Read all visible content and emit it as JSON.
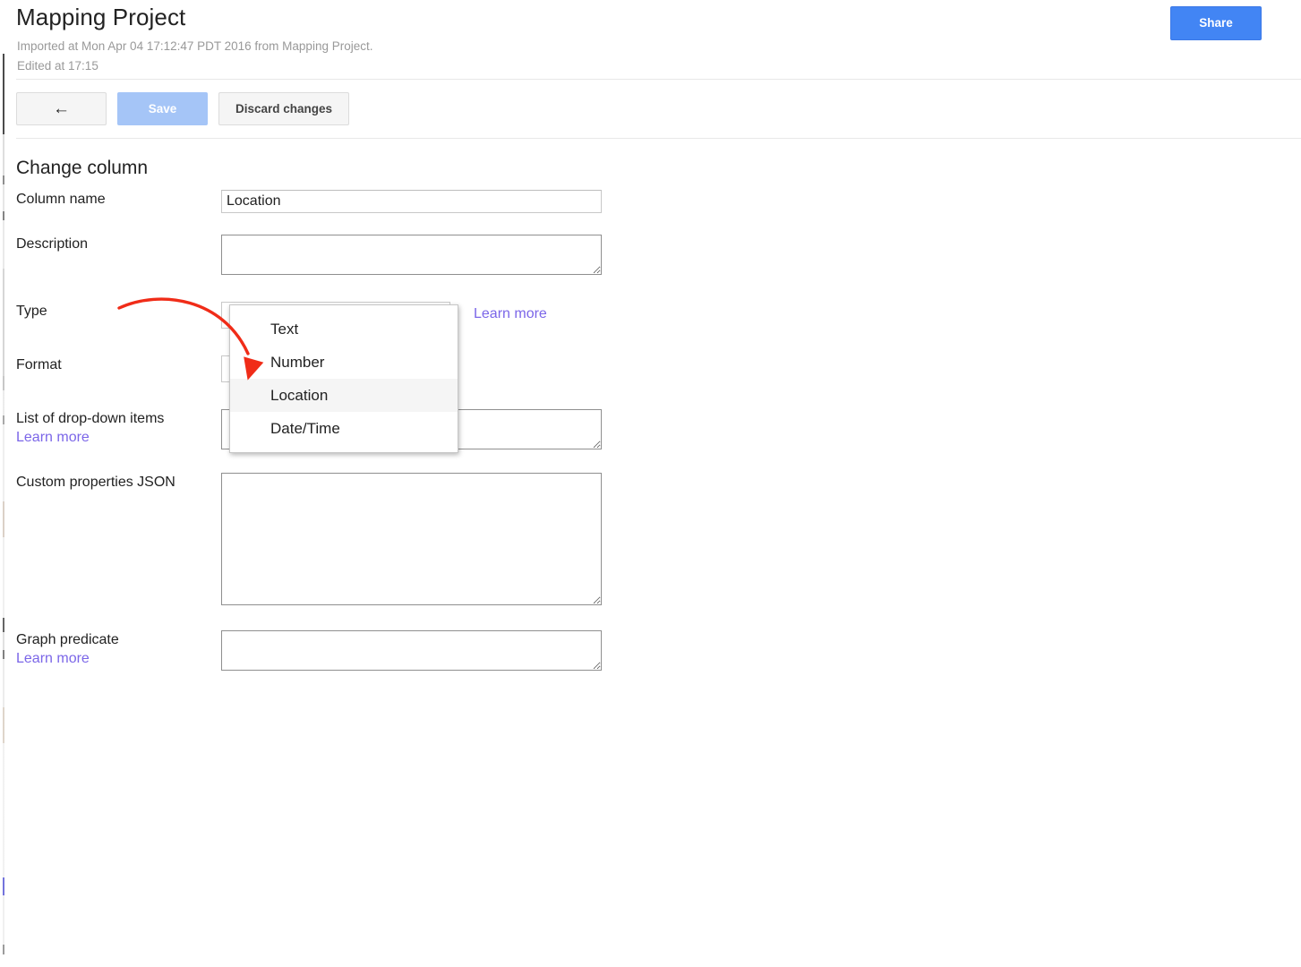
{
  "header": {
    "title": "Mapping Project",
    "imported_line": "Imported at Mon Apr 04 17:12:47 PDT 2016 from Mapping Project.",
    "edited_line": "Edited at 17:15",
    "share_label": "Share"
  },
  "toolbar": {
    "undo_icon": "undo-arrow-icon",
    "undo_glyph": "←",
    "save_label": "Save",
    "discard_label": "Discard changes"
  },
  "section": {
    "title": "Change column"
  },
  "fields": {
    "column_name": {
      "label": "Column name",
      "value": "Location",
      "placeholder": ""
    },
    "description": {
      "label": "Description",
      "value": "",
      "placeholder": ""
    },
    "type": {
      "label": "Type",
      "value": "Location",
      "learn_more": "Learn more",
      "options": [
        "Text",
        "Number",
        "Location",
        "Date/Time"
      ]
    },
    "format": {
      "label": "Format",
      "value": ""
    },
    "dropdown_items": {
      "label": "List of drop-down items",
      "learn_more": "Learn more",
      "value": ""
    },
    "custom_properties": {
      "label": "Custom properties JSON",
      "value": ""
    },
    "graph_predicate": {
      "label": "Graph predicate",
      "learn_more": "Learn more",
      "value": ""
    }
  },
  "open_menu": {
    "name": "type-select-menu",
    "items": [
      {
        "label": "Text",
        "selected": false
      },
      {
        "label": "Number",
        "selected": false
      },
      {
        "label": "Location",
        "selected": true
      },
      {
        "label": "Date/Time",
        "selected": false
      }
    ]
  },
  "annotation": {
    "kind": "curved-arrow",
    "color": "#f02c18",
    "points_to": "Location"
  },
  "colors": {
    "accent_blue": "#4285f4",
    "save_disabled_blue": "#a5c5f7",
    "link_purple": "#7b66e8",
    "annotation_red": "#f02c18",
    "text": "#222222",
    "muted_text": "#999999",
    "rule": "#e8e8e8"
  }
}
